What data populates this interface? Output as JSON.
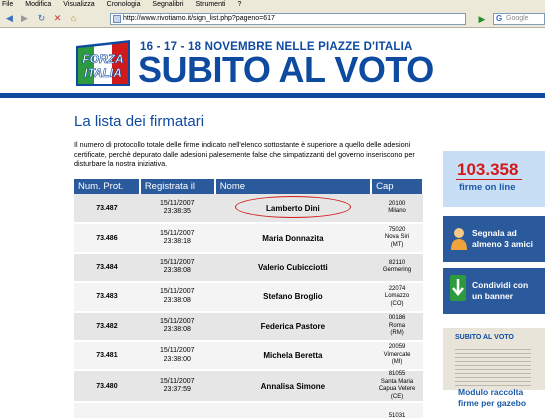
{
  "browser": {
    "menu": [
      "File",
      "Modifica",
      "Visualizza",
      "Cronologia",
      "Segnalibri",
      "Strumenti",
      "?"
    ],
    "url": "http://www.rivotiamo.it/sign_list.php?pageno=617",
    "search_placeholder": "Google"
  },
  "banner": {
    "logo_top": "FORZA",
    "logo_bottom": "ITALIA",
    "dates": "16 - 17 - 18 NOVEMBRE NELLE PIAZZE D'ITALIA",
    "title": "SUBITO AL VOTO",
    "brand_blue": "#0e4aa0"
  },
  "main": {
    "heading": "La lista dei firmatari",
    "intro": "Il numero di protocollo totale delle firme indicato nell'elenco sottostante è superiore a quello delle adesioni certificate, perchè depurato dalle adesioni palesemente false che simpatizzanti del governo inseriscono per disturbare la nostra iniziativa.",
    "columns": [
      "Num. Prot.",
      "Registrata il",
      "Nome",
      "Cap"
    ],
    "rows": [
      {
        "num": "73.487",
        "date": "15/11/2007",
        "time": "23:38:35",
        "name": "Lamberto Dini",
        "cap": [
          "20100",
          "Milano"
        ]
      },
      {
        "num": "73.486",
        "date": "15/11/2007",
        "time": "23:38:18",
        "name": "Maria Donnazita",
        "cap": [
          "75020",
          "Nova Siri",
          "(MT)"
        ]
      },
      {
        "num": "73.484",
        "date": "15/11/2007",
        "time": "23:38:08",
        "name": "Valerio Cubicciotti",
        "cap": [
          "82110",
          "Germering"
        ]
      },
      {
        "num": "73.483",
        "date": "15/11/2007",
        "time": "23:38:08",
        "name": "Stefano Broglio",
        "cap": [
          "22074",
          "Lomazzo",
          "(CO)"
        ]
      },
      {
        "num": "73.482",
        "date": "15/11/2007",
        "time": "23:38:08",
        "name": "Federica Pastore",
        "cap": [
          "00186",
          "Roma",
          "(RM)"
        ]
      },
      {
        "num": "73.481",
        "date": "15/11/2007",
        "time": "23:38:00",
        "name": "Michela Beretta",
        "cap": [
          "20059",
          "Vimercate",
          "(MI)"
        ]
      },
      {
        "num": "73.480",
        "date": "15/11/2007",
        "time": "23:37:59",
        "name": "Annalisa Simone",
        "cap": [
          "81055",
          "Santa Maria",
          "Capua Vetere",
          "(CE)"
        ]
      },
      {
        "num": "",
        "date": "",
        "time": "",
        "name": "",
        "cap": [
          "51031"
        ]
      }
    ]
  },
  "sidebar": {
    "counter": "103.358",
    "counter_label": "firme on line",
    "report_line1": "Segnala ad",
    "report_line2": "almeno 3 amici",
    "share_line1": "Condividi con",
    "share_line2": "un banner",
    "thumb_title": "SUBITO AL VOTO",
    "modulo_line1": "Modulo raccolta",
    "modulo_line2": "firme per gazebo"
  }
}
